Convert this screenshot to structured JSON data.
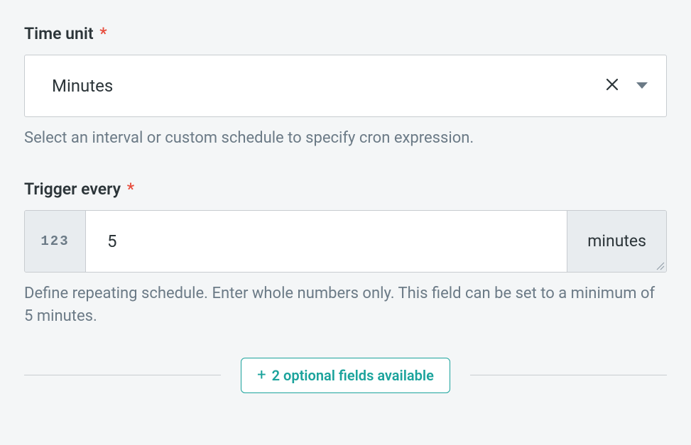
{
  "time_unit": {
    "label": "Time unit",
    "required_mark": "*",
    "value": "Minutes",
    "helper": "Select an interval or custom schedule to specify cron expression."
  },
  "trigger_every": {
    "label": "Trigger every",
    "required_mark": "*",
    "prefix": "123",
    "value": "5",
    "suffix": "minutes",
    "helper": "Define repeating schedule. Enter whole numbers only. This field can be set to a minimum of 5 minutes."
  },
  "optional_fields": {
    "plus": "+",
    "label": "2 optional fields available"
  }
}
